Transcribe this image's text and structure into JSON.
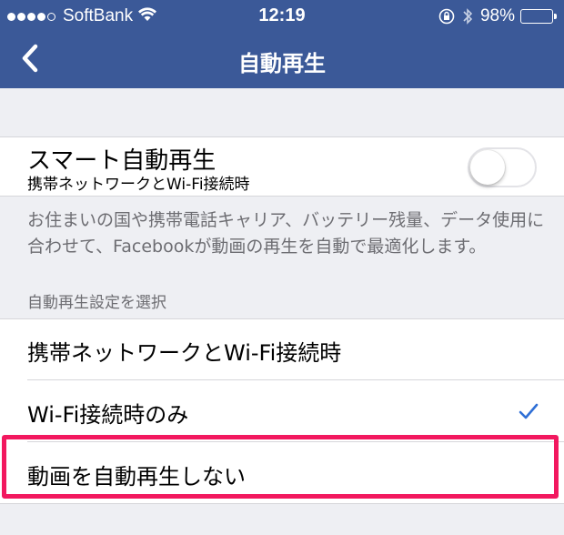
{
  "status_bar": {
    "carrier": "SoftBank",
    "time": "12:19",
    "battery": "98%",
    "signal_icon": "signal-dots-icon",
    "wifi_icon": "wifi-icon",
    "rotation_lock_icon": "rotation-lock-icon",
    "bluetooth_icon": "bluetooth-icon",
    "battery_icon": "battery-icon"
  },
  "nav": {
    "title": "自動再生",
    "back_icon": "chevron-left-icon",
    "color": "#3b5998"
  },
  "smart_autoplay": {
    "title": "スマート自動再生",
    "subtitle": "携帯ネットワークとWi-Fi接続時",
    "enabled": false,
    "description": "お住まいの国や携帯電話キャリア、バッテリー残量、データ使用に合わせて、Facebookが動画の再生を自動で最適化します。"
  },
  "section": {
    "header": "自動再生設定を選択",
    "options": [
      {
        "label": "携帯ネットワークとWi-Fi接続時",
        "selected": false
      },
      {
        "label": "Wi-Fi接続時のみ",
        "selected": true
      },
      {
        "label": "動画を自動再生しない",
        "selected": false,
        "highlighted": true
      }
    ],
    "check_color": "#2f6fd6",
    "highlight_color": "#f2185f"
  }
}
